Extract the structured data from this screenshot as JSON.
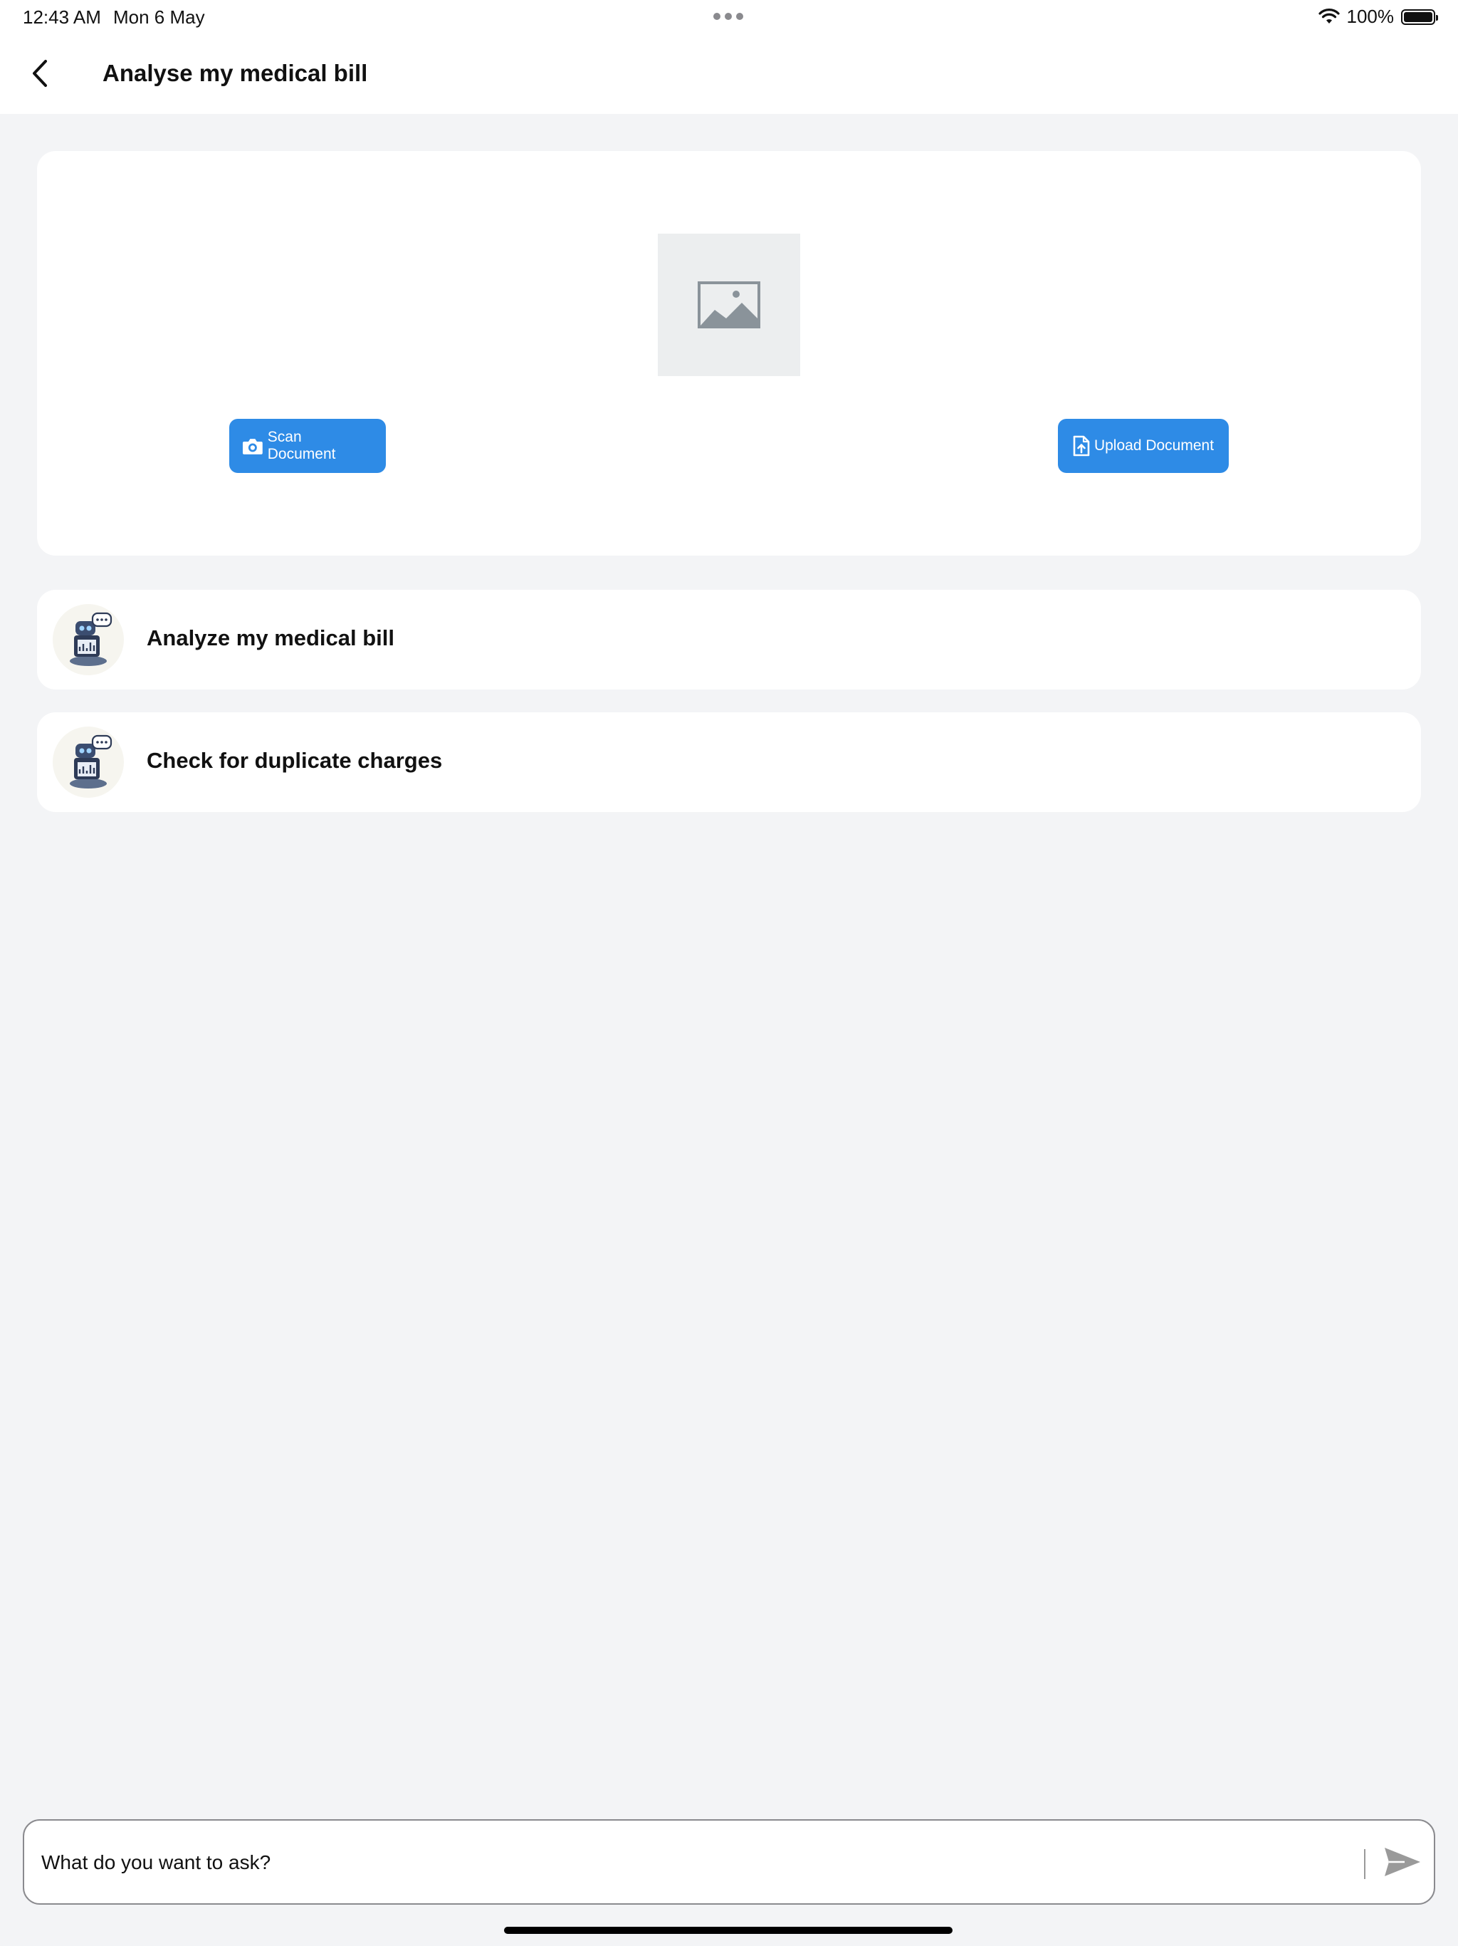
{
  "status_bar": {
    "time": "12:43 AM",
    "date": "Mon 6 May",
    "battery": "100%"
  },
  "nav": {
    "title": "Analyse my medical bill",
    "back_icon": "chevron-left-icon"
  },
  "upload_card": {
    "placeholder_icon": "image-icon",
    "scan_label": "Scan Document",
    "scan_icon": "camera-icon",
    "upload_label": "Upload Document",
    "upload_icon": "file-upload-icon",
    "accent_color": "#2e8be6"
  },
  "prompts": [
    {
      "label": "Analyze my medical bill",
      "icon": "robot-assistant-avatar"
    },
    {
      "label": "Check for duplicate charges",
      "icon": "robot-assistant-avatar"
    }
  ],
  "chat": {
    "placeholder": "What do you want to ask?",
    "send_icon": "send-icon"
  }
}
